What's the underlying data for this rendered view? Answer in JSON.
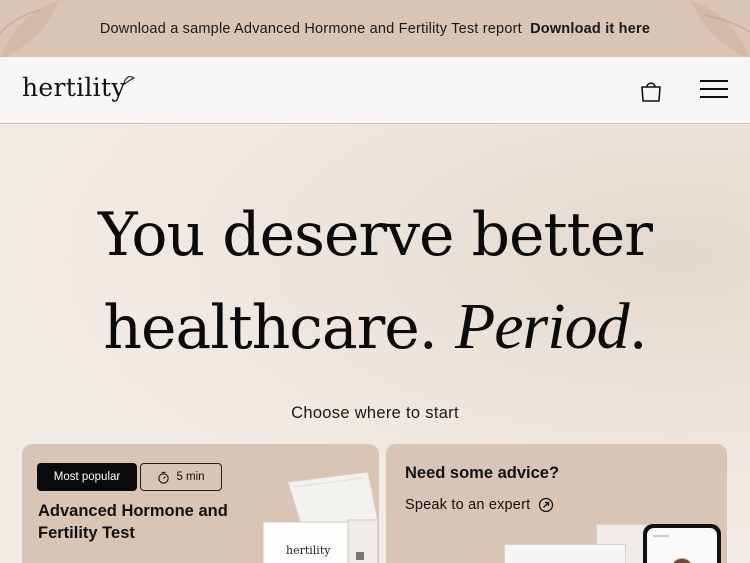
{
  "announcement": {
    "text": "Download a sample Advanced Hormone and Fertility Test report",
    "link": "Download it here"
  },
  "header": {
    "logo": "hertility",
    "icons": [
      "shopping-bag-icon",
      "hamburger-menu-icon"
    ]
  },
  "hero": {
    "headline_line1": "You deserve better",
    "headline_line2_main": "healthcare.",
    "headline_line2_italic": "Period",
    "headline_line2_end": ".",
    "choose": "Choose where to start"
  },
  "cards": {
    "test": {
      "badge_popular": "Most popular",
      "badge_time": "5 min",
      "title": "Advanced Hormone and Fertility Test",
      "product_label": "hertility"
    },
    "advice": {
      "title": "Need some advice?",
      "link": "Speak to an expert"
    }
  },
  "colors": {
    "announcement_bg": "#d9c5b6",
    "card_bg": "#d9c5b6",
    "header_bg": "#f9f7f5",
    "hero_bg": "#f1ebe5"
  }
}
